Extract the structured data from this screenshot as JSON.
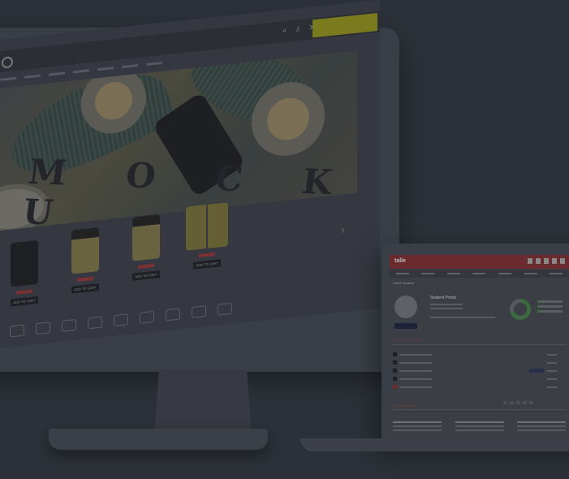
{
  "monitor": {
    "shop": {
      "cart_label": "",
      "hero_text": "M O C K U"
    },
    "products": [
      {
        "name": "",
        "badge": "",
        "price": "",
        "add_label": "ADD TO CART"
      },
      {
        "name": "",
        "badge": "",
        "price": "",
        "add_label": "ADD TO CART"
      },
      {
        "name": "",
        "badge": "",
        "price": "",
        "add_label": "ADD TO CART"
      },
      {
        "name": "",
        "badge": "",
        "price": "",
        "add_label": "ADD TO CART"
      }
    ],
    "carousel_arrow": "›"
  },
  "laptop": {
    "portal": {
      "logo": "talle",
      "breadcrumb": "Home Student",
      "title": "Student Portal",
      "notifications_title": "MY NOTIFICATIONS",
      "timetable_title": "MY TIMETABLE"
    }
  },
  "colors": {
    "background": "#2c3038",
    "portal_header": "#6a2a2e",
    "accent_green": "#3a6a3e",
    "shop_cart_yellow": "#7a7a1f"
  }
}
